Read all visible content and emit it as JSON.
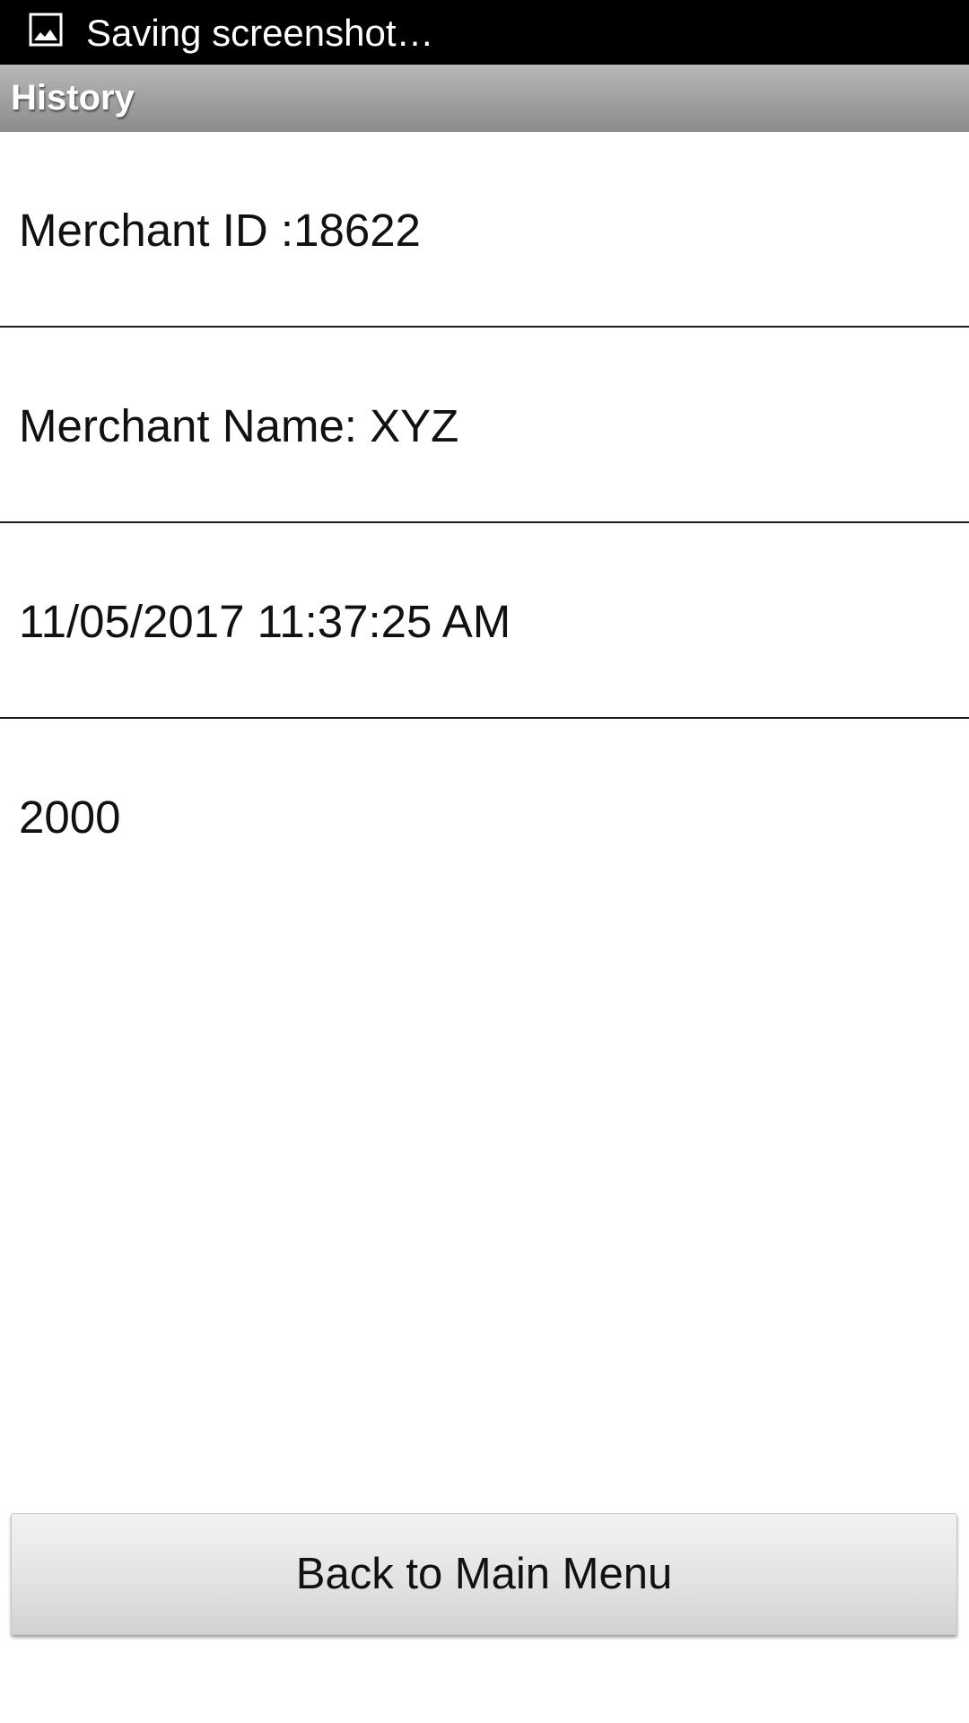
{
  "status_bar": {
    "icon": "image-icon",
    "text": "Saving screenshot…",
    "background": "#000000"
  },
  "title_bar": {
    "title": "History"
  },
  "details": {
    "merchant_id": "Merchant ID :18622",
    "merchant_name": "Merchant Name: XYZ",
    "datetime": "11/05/2017 11:37:25 AM",
    "amount": "2000"
  },
  "actions": {
    "back_label": "Back to Main Menu"
  }
}
